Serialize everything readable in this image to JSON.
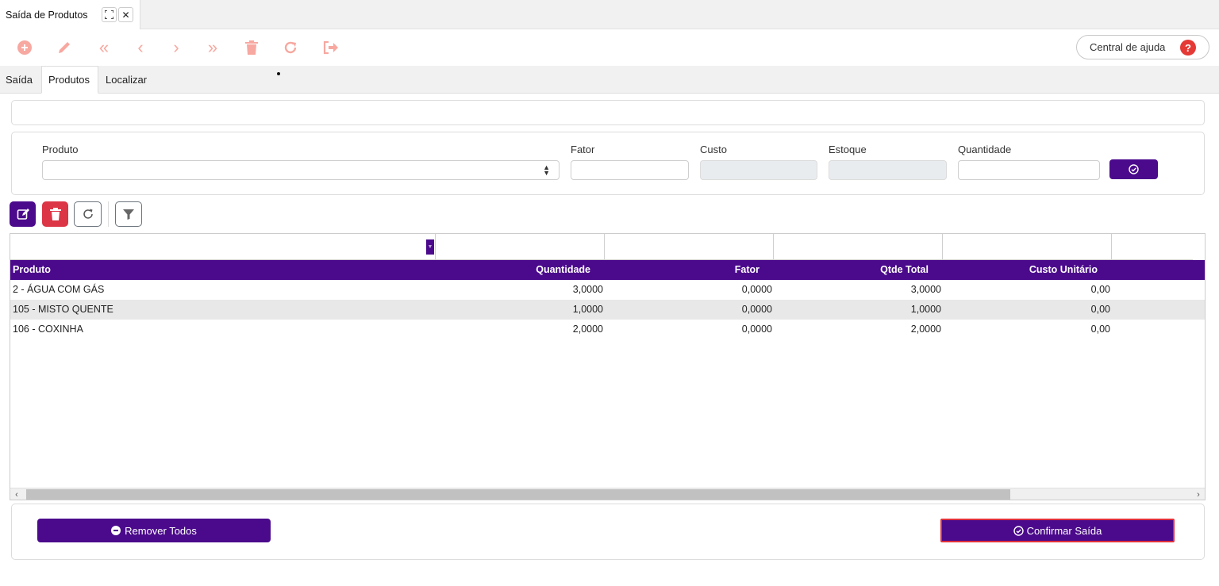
{
  "window_tab": {
    "title": "Saída de Produtos",
    "expand_icon": "expand-icon",
    "close_icon": "close-icon"
  },
  "toolbar": {
    "icons": [
      "add-icon",
      "edit-icon",
      "first-icon",
      "previous-icon",
      "next-icon",
      "last-icon",
      "delete-icon",
      "refresh-icon",
      "exit-icon"
    ],
    "icon_color": "#f7a8a0",
    "help_label": "Central de ajuda",
    "help_icon": "question-icon"
  },
  "subtabs": [
    {
      "label": "Saída",
      "active": false
    },
    {
      "label": "Produtos",
      "active": true
    },
    {
      "label": "Localizar",
      "active": false
    }
  ],
  "form": {
    "produto_label": "Produto",
    "produto_value": "",
    "fator_label": "Fator",
    "fator_value": "",
    "custo_label": "Custo",
    "custo_value": "",
    "estoque_label": "Estoque",
    "estoque_value": "",
    "quantidade_label": "Quantidade",
    "quantidade_value": "",
    "confirm_icon": "check-circle-icon"
  },
  "grid_actions": [
    "edit-icon",
    "delete-icon",
    "refresh-icon",
    "filter-icon"
  ],
  "grid": {
    "columns": [
      "Produto",
      "Quantidade",
      "Fator",
      "Qtde Total",
      "Custo Unitário"
    ],
    "rows": [
      [
        "2 - ÁGUA COM GÁS",
        "3,0000",
        "0,0000",
        "3,0000",
        "0,00"
      ],
      [
        "105 - MISTO QUENTE",
        "1,0000",
        "0,0000",
        "1,0000",
        "0,00"
      ],
      [
        "106 - COXINHA",
        "2,0000",
        "0,0000",
        "2,0000",
        "0,00"
      ]
    ],
    "header_color": "#4b0a8c"
  },
  "footer": {
    "remove_all_label": "Remover Todos",
    "confirm_label": "Confirmar Saída"
  },
  "colors": {
    "accent": "#4b0a8c",
    "danger": "#dc3545",
    "toolbar_icon": "#f7a8a0"
  }
}
